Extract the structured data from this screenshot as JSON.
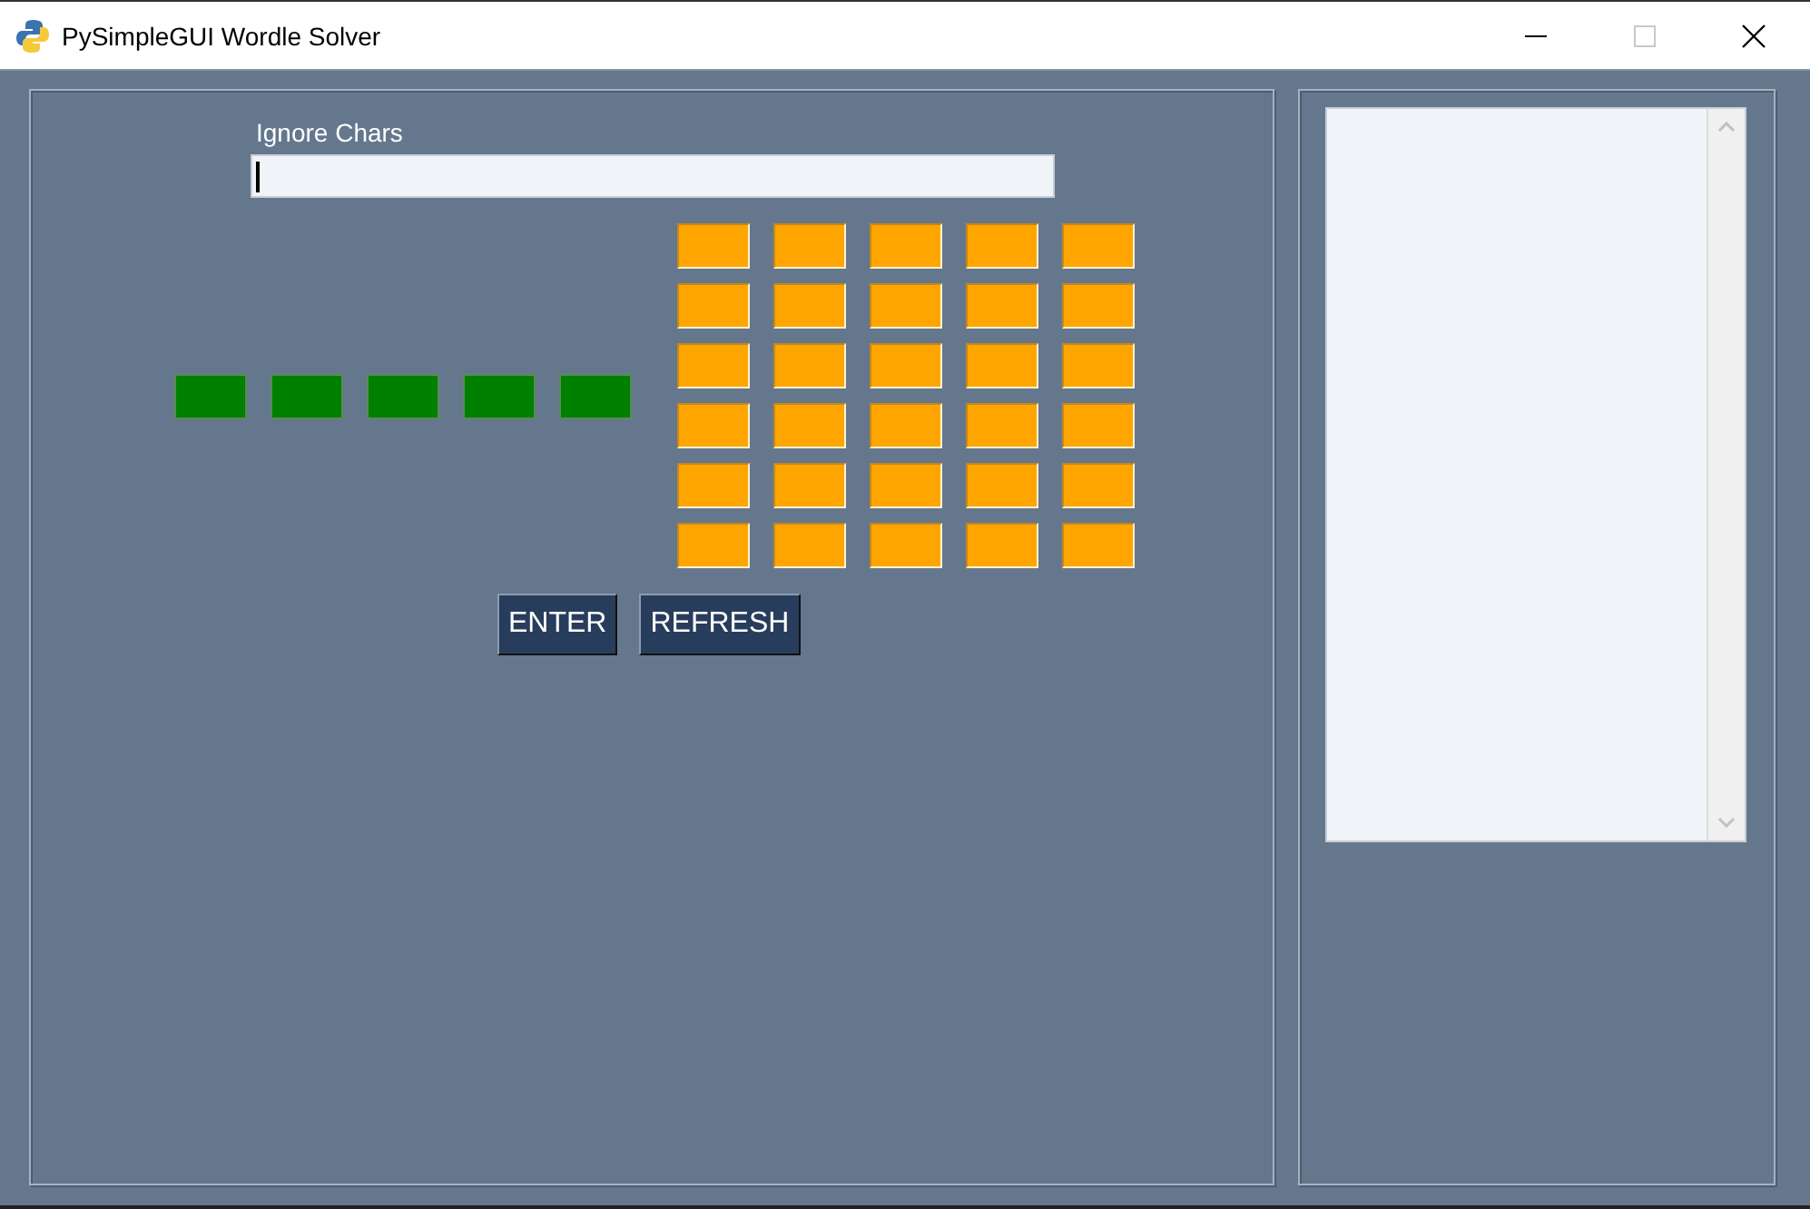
{
  "window": {
    "title": "PySimpleGUI Wordle Solver",
    "maximize_disabled": true
  },
  "ignore_chars": {
    "label": "Ignore Chars",
    "focused": true
  },
  "known_letters": [
    {
      "color": "#008000"
    },
    {
      "color": "#008000"
    },
    {
      "color": "#008000"
    },
    {
      "color": "#008000"
    },
    {
      "color": "#008000"
    }
  ],
  "guess_grid": [
    [
      {
        "color": "#ffa500"
      },
      {
        "color": "#ffa500"
      },
      {
        "color": "#ffa500"
      },
      {
        "color": "#ffa500"
      },
      {
        "color": "#ffa500"
      }
    ],
    [
      {
        "color": "#ffa500"
      },
      {
        "color": "#ffa500"
      },
      {
        "color": "#ffa500"
      },
      {
        "color": "#ffa500"
      },
      {
        "color": "#ffa500"
      }
    ],
    [
      {
        "color": "#ffa500"
      },
      {
        "color": "#ffa500"
      },
      {
        "color": "#ffa500"
      },
      {
        "color": "#ffa500"
      },
      {
        "color": "#ffa500"
      }
    ],
    [
      {
        "color": "#ffa500"
      },
      {
        "color": "#ffa500"
      },
      {
        "color": "#ffa500"
      },
      {
        "color": "#ffa500"
      },
      {
        "color": "#ffa500"
      }
    ],
    [
      {
        "color": "#ffa500"
      },
      {
        "color": "#ffa500"
      },
      {
        "color": "#ffa500"
      },
      {
        "color": "#ffa500"
      },
      {
        "color": "#ffa500"
      }
    ],
    [
      {
        "color": "#ffa500"
      },
      {
        "color": "#ffa500"
      },
      {
        "color": "#ffa500"
      },
      {
        "color": "#ffa500"
      },
      {
        "color": "#ffa500"
      }
    ]
  ],
  "buttons": [
    "ENTER",
    "REFRESH"
  ]
}
